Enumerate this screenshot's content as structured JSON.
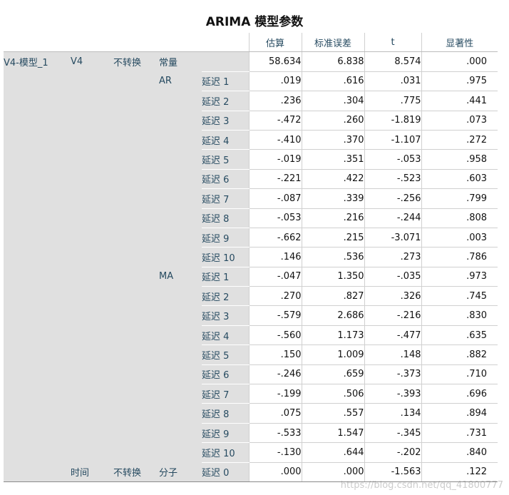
{
  "title": "ARIMA 模型参数",
  "headers": {
    "estimate": "估算",
    "std_error": "标准误差",
    "t": "t",
    "sig": "显著性"
  },
  "model": "V4-模型_1",
  "variable": "V4",
  "transform": "不转换",
  "constant_label": "常量",
  "constant": {
    "estimate": "58.634",
    "std_error": "6.838",
    "t": "8.574",
    "sig": ".000"
  },
  "ar_label": "AR",
  "ar": [
    {
      "lag": "延迟 1",
      "estimate": ".019",
      "std_error": ".616",
      "t": ".031",
      "sig": ".975"
    },
    {
      "lag": "延迟 2",
      "estimate": ".236",
      "std_error": ".304",
      "t": ".775",
      "sig": ".441"
    },
    {
      "lag": "延迟 3",
      "estimate": "-.472",
      "std_error": ".260",
      "t": "-1.819",
      "sig": ".073"
    },
    {
      "lag": "延迟 4",
      "estimate": "-.410",
      "std_error": ".370",
      "t": "-1.107",
      "sig": ".272"
    },
    {
      "lag": "延迟 5",
      "estimate": "-.019",
      "std_error": ".351",
      "t": "-.053",
      "sig": ".958"
    },
    {
      "lag": "延迟 6",
      "estimate": "-.221",
      "std_error": ".422",
      "t": "-.523",
      "sig": ".603"
    },
    {
      "lag": "延迟 7",
      "estimate": "-.087",
      "std_error": ".339",
      "t": "-.256",
      "sig": ".799"
    },
    {
      "lag": "延迟 8",
      "estimate": "-.053",
      "std_error": ".216",
      "t": "-.244",
      "sig": ".808"
    },
    {
      "lag": "延迟 9",
      "estimate": "-.662",
      "std_error": ".215",
      "t": "-3.071",
      "sig": ".003"
    },
    {
      "lag": "延迟 10",
      "estimate": ".146",
      "std_error": ".536",
      "t": ".273",
      "sig": ".786"
    }
  ],
  "ma_label": "MA",
  "ma": [
    {
      "lag": "延迟 1",
      "estimate": "-.047",
      "std_error": "1.350",
      "t": "-.035",
      "sig": ".973"
    },
    {
      "lag": "延迟 2",
      "estimate": ".270",
      "std_error": ".827",
      "t": ".326",
      "sig": ".745"
    },
    {
      "lag": "延迟 3",
      "estimate": "-.579",
      "std_error": "2.686",
      "t": "-.216",
      "sig": ".830"
    },
    {
      "lag": "延迟 4",
      "estimate": "-.560",
      "std_error": "1.173",
      "t": "-.477",
      "sig": ".635"
    },
    {
      "lag": "延迟 5",
      "estimate": ".150",
      "std_error": "1.009",
      "t": ".148",
      "sig": ".882"
    },
    {
      "lag": "延迟 6",
      "estimate": "-.246",
      "std_error": ".659",
      "t": "-.373",
      "sig": ".710"
    },
    {
      "lag": "延迟 7",
      "estimate": "-.199",
      "std_error": ".506",
      "t": "-.393",
      "sig": ".696"
    },
    {
      "lag": "延迟 8",
      "estimate": ".075",
      "std_error": ".557",
      "t": ".134",
      "sig": ".894"
    },
    {
      "lag": "延迟 9",
      "estimate": "-.533",
      "std_error": "1.547",
      "t": "-.345",
      "sig": ".731"
    },
    {
      "lag": "延迟 10",
      "estimate": "-.130",
      "std_error": ".644",
      "t": "-.202",
      "sig": ".840"
    }
  ],
  "time": {
    "label": "时间",
    "transform": "不转换",
    "numerator_label": "分子",
    "lag": "延迟 0",
    "estimate": ".000",
    "std_error": ".000",
    "t": "-1.563",
    "sig": ".122"
  },
  "watermark": "https://blog.csdn.net/qq_41800777"
}
